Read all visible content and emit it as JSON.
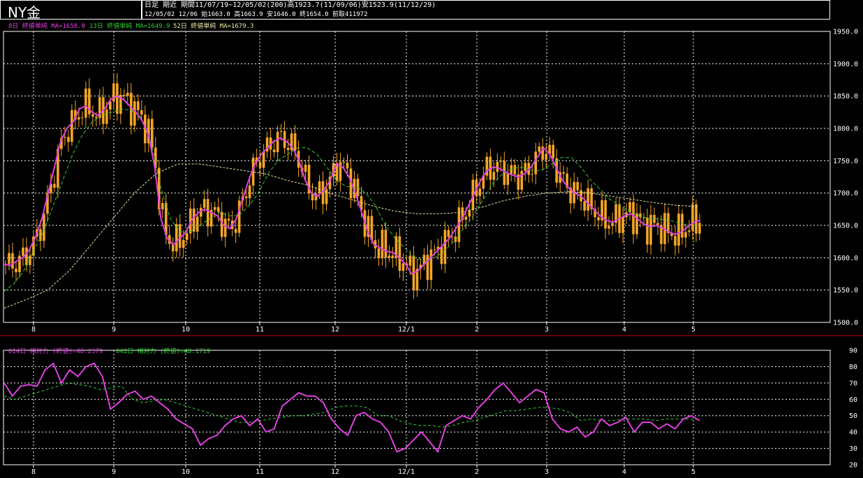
{
  "header": {
    "title": "NY金",
    "info_line_1": "日足 期近 期間11/07/19~12/05/02(200)高1923.7(11/09/06)安1523.9(11/12/29)",
    "info_line_2": "12/05/02 12/06 始1663.0 高1663.9 安1646.0 終1654.0 前取411972"
  },
  "legends": {
    "ma8": "8日 終値単純 MA=1658.0",
    "ma13": "13日 終値単純 MA=1649.9",
    "ma52": "52日 終値単純 MA=1679.3",
    "rsi14": "014日 相対力 (終値)=48.2379",
    "rsi42": "042日 相対力 (終値)=48.1719"
  },
  "colors": {
    "background": "#000000",
    "candle": "#f5a623",
    "ma_short": "#e040e0",
    "ma_mid": "#33cc33",
    "ma_long": "#e8e8a0",
    "rsi": "#e040e0",
    "rsi_slow": "#33cc33",
    "grid": "#ffffff",
    "separator": "#cc0000"
  },
  "chart_data": [
    {
      "type": "line",
      "title": "NY金",
      "note": "daily candlestick chart of NY gold futures with moving averages; values estimated from the axis",
      "ylim": [
        1500,
        1950
      ],
      "y_ticks": [
        "1950.0",
        "1900.0",
        "1850.0",
        "1800.0",
        "1750.0",
        "1700.0",
        "1650.0",
        "1600.0",
        "1550.0",
        "1500.0"
      ],
      "x_ticks": [
        "8",
        "9",
        "10",
        "11",
        "12",
        "12/1",
        "2",
        "3",
        "4",
        "5"
      ],
      "grid": true,
      "series": [
        {
          "name": "8日 終値単純",
          "values": [
            1590,
            1588,
            1595,
            1600,
            1612,
            1632,
            1660,
            1700,
            1740,
            1780,
            1800,
            1810,
            1830,
            1835,
            1825,
            1820,
            1830,
            1845,
            1850,
            1845,
            1835,
            1825,
            1812,
            1790,
            1740,
            1660,
            1630,
            1620,
            1630,
            1640,
            1660,
            1670,
            1675,
            1670,
            1665,
            1650,
            1645,
            1660,
            1690,
            1720,
            1745,
            1760,
            1770,
            1780,
            1785,
            1780,
            1770,
            1750,
            1720,
            1700,
            1695,
            1705,
            1720,
            1745,
            1740,
            1725,
            1700,
            1670,
            1640,
            1620,
            1615,
            1610,
            1608,
            1600,
            1590,
            1575,
            1580,
            1590,
            1600,
            1610,
            1620,
            1630,
            1645,
            1660,
            1680,
            1700,
            1720,
            1735,
            1740,
            1738,
            1732,
            1728,
            1725,
            1730,
            1740,
            1755,
            1770,
            1760,
            1740,
            1720,
            1708,
            1700,
            1695,
            1685,
            1675,
            1665,
            1658,
            1655,
            1660,
            1665,
            1668,
            1660,
            1652,
            1648,
            1650,
            1646,
            1640,
            1636,
            1640,
            1648,
            1655,
            1658
          ]
        },
        {
          "name": "13日 終値単純",
          "values": [
            1548,
            1560,
            1580,
            1610,
            1640,
            1680,
            1720,
            1760,
            1790,
            1810,
            1820,
            1825,
            1830,
            1828,
            1818,
            1780,
            1710,
            1660,
            1640,
            1640,
            1650,
            1660,
            1670,
            1665,
            1665,
            1680,
            1700,
            1730,
            1750,
            1760,
            1770,
            1770,
            1760,
            1740,
            1720,
            1710,
            1710,
            1700,
            1680,
            1650,
            1630,
            1615,
            1600,
            1595,
            1600,
            1610,
            1625,
            1645,
            1665,
            1690,
            1715,
            1730,
            1738,
            1740,
            1735,
            1735,
            1745,
            1755,
            1755,
            1740,
            1720,
            1705,
            1690,
            1680,
            1672,
            1665,
            1660,
            1660,
            1658,
            1654,
            1650,
            1650
          ]
        },
        {
          "name": "52日 終値単純",
          "values": [
            1522,
            1535,
            1550,
            1580,
            1620,
            1660,
            1700,
            1730,
            1745,
            1745,
            1740,
            1735,
            1730,
            1720,
            1712,
            1700,
            1690,
            1680,
            1672,
            1668,
            1668,
            1670,
            1678,
            1688,
            1695,
            1700,
            1702,
            1700,
            1695,
            1690,
            1685,
            1681,
            1679
          ]
        }
      ]
    },
    {
      "type": "line",
      "title": "相対力",
      "ylim": [
        20,
        90
      ],
      "y_ticks": [
        "90",
        "80",
        "70",
        "60",
        "50",
        "40",
        "30",
        "20"
      ],
      "x_ticks": [
        "8",
        "9",
        "10",
        "11",
        "12",
        "12/1",
        "2",
        "3",
        "4",
        "5"
      ],
      "grid": true,
      "series": [
        {
          "name": "014日 相対力 (終値)",
          "values": [
            70,
            62,
            68,
            69,
            68,
            78,
            82,
            70,
            78,
            74,
            80,
            82,
            74,
            54,
            58,
            63,
            65,
            60,
            62,
            58,
            54,
            48,
            45,
            42,
            32,
            36,
            38,
            44,
            48,
            50,
            44,
            48,
            40,
            42,
            56,
            60,
            64,
            62,
            62,
            58,
            48,
            42,
            38,
            50,
            52,
            48,
            46,
            40,
            28,
            30,
            35,
            40,
            34,
            28,
            44,
            47,
            50,
            48,
            55,
            60,
            66,
            70,
            64,
            58,
            62,
            66,
            64,
            48,
            42,
            40,
            43,
            37,
            40,
            48,
            44,
            46,
            49,
            40,
            46,
            46,
            42,
            45,
            42,
            48,
            50,
            47
          ]
        },
        {
          "name": "042日 相対力 (終値)",
          "values": [
            62,
            60,
            62,
            64,
            66,
            68,
            70,
            69,
            68,
            66,
            67,
            68,
            60,
            58,
            59,
            60,
            58,
            56,
            54,
            52,
            50,
            48,
            46,
            46,
            47,
            48,
            49,
            50,
            50,
            51,
            52,
            55,
            56,
            56,
            55,
            50,
            50,
            47,
            45,
            44,
            44,
            43,
            44,
            46,
            47,
            49,
            51,
            53,
            53,
            54,
            55,
            55,
            54,
            52,
            47,
            48,
            47,
            47,
            48,
            48,
            48,
            47,
            48,
            48,
            48,
            48
          ]
        }
      ]
    }
  ]
}
